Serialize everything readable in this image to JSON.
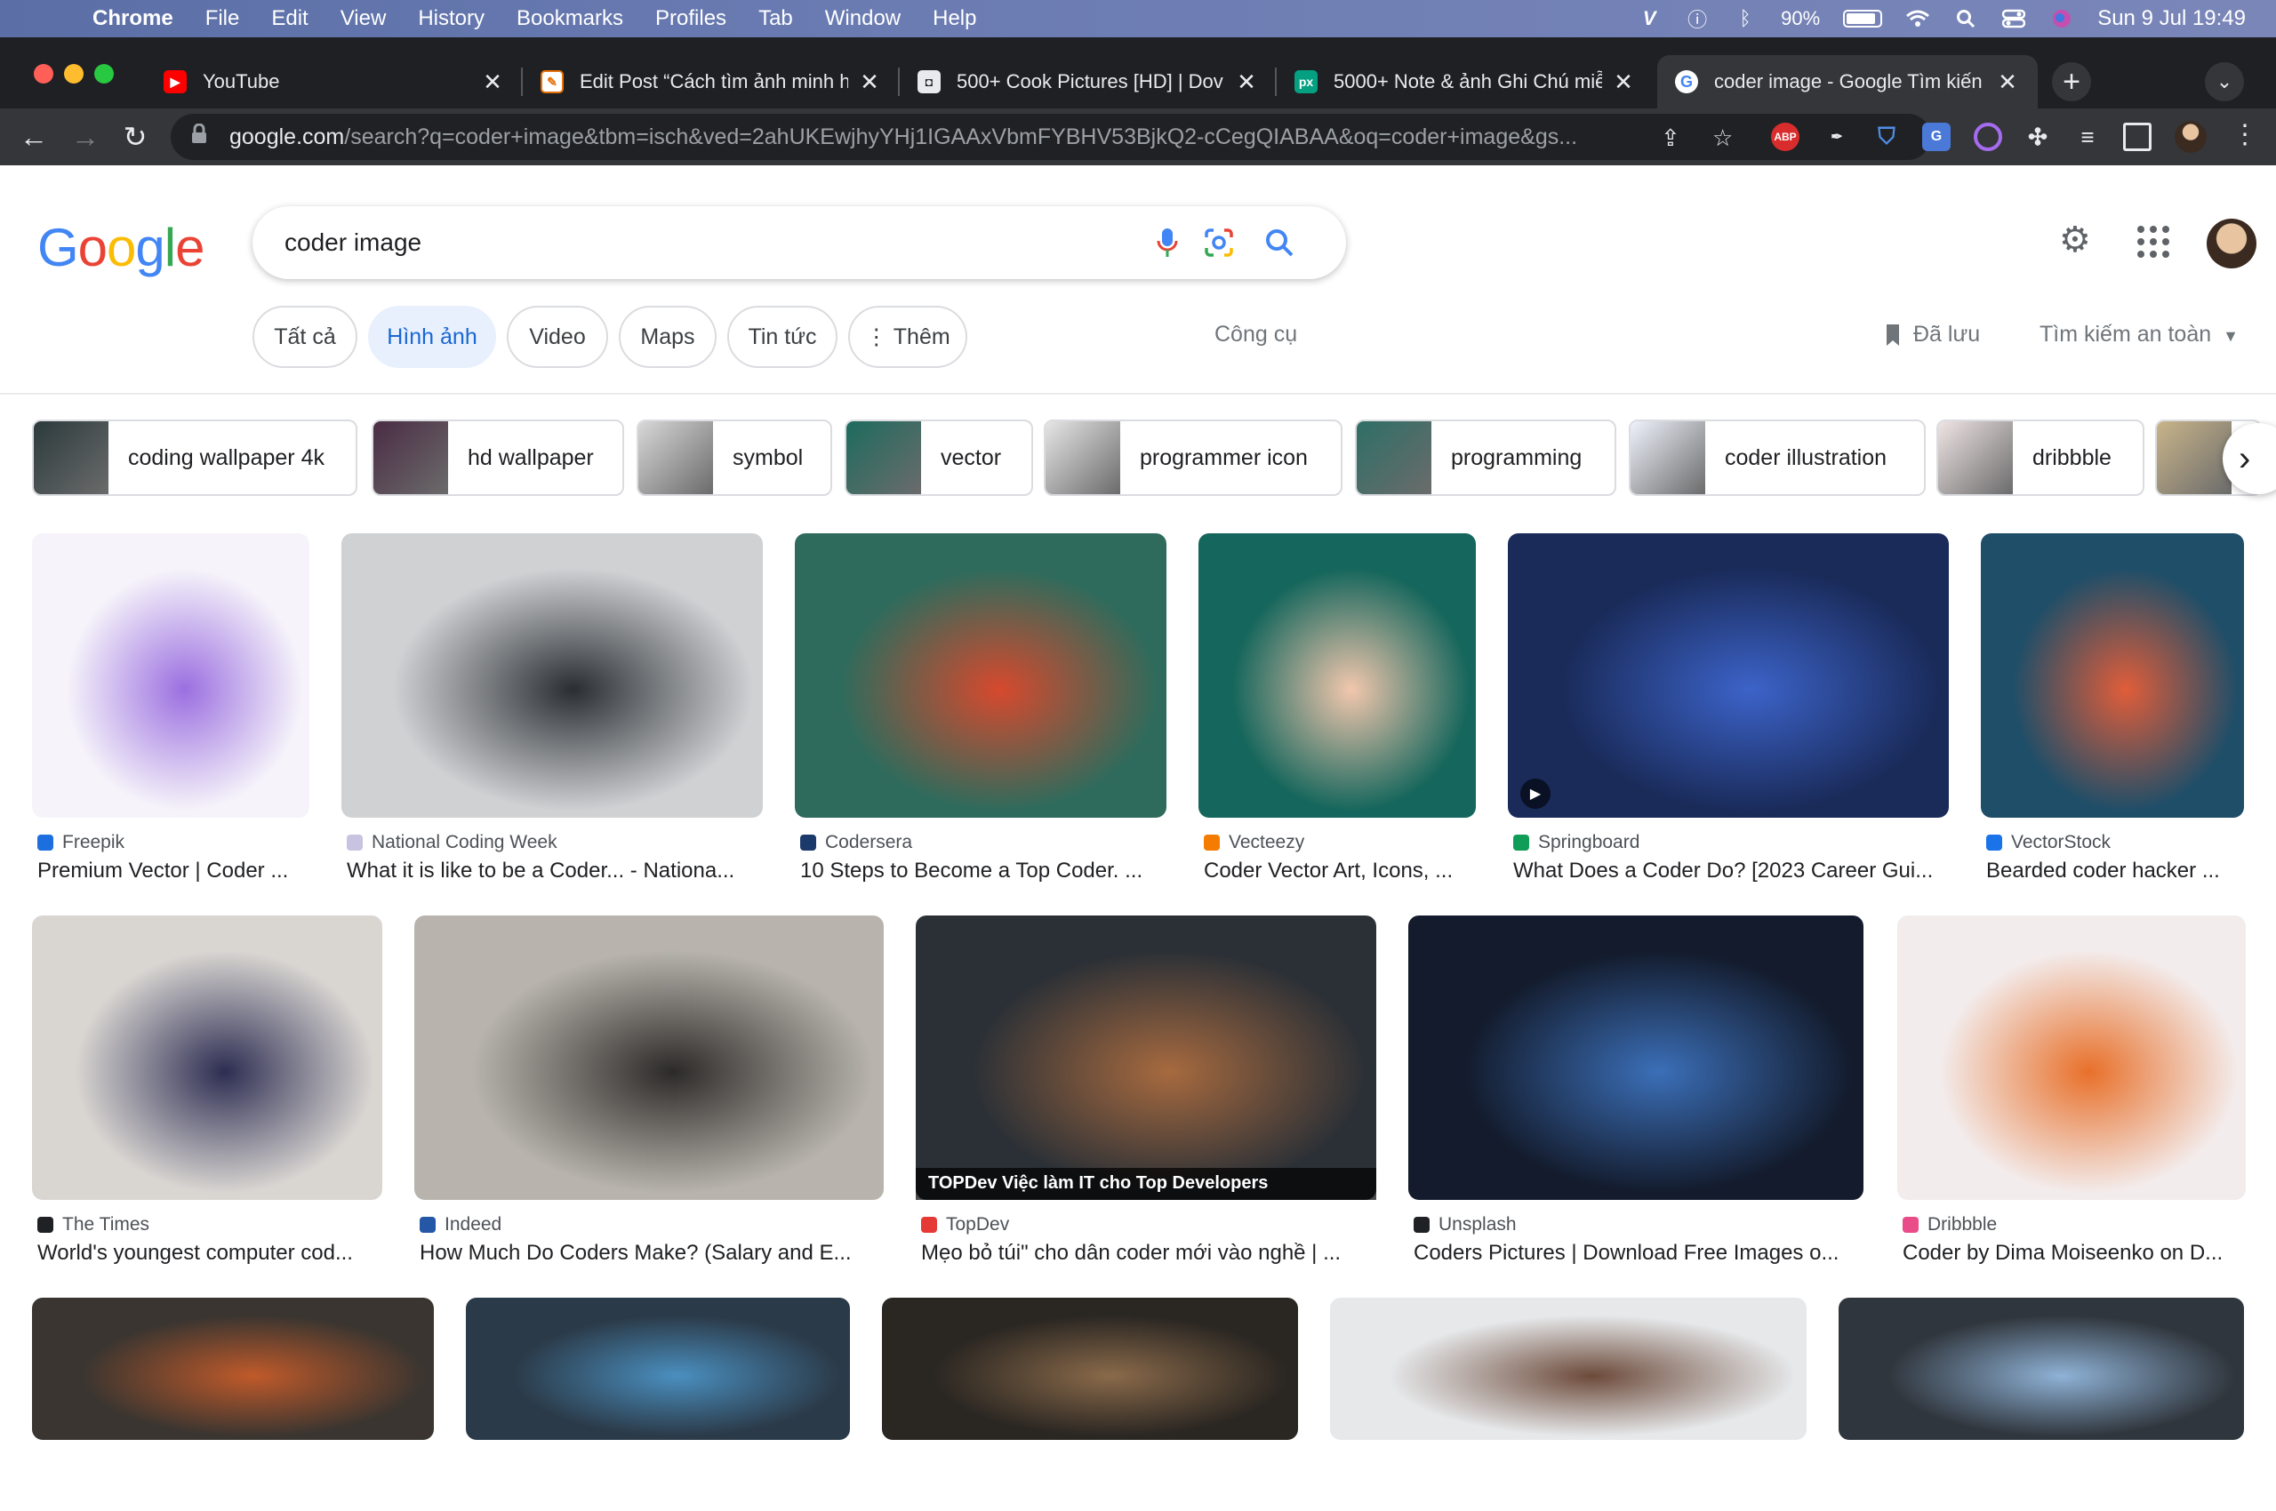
{
  "menubar": {
    "app": "Chrome",
    "items": [
      "File",
      "Edit",
      "View",
      "History",
      "Bookmarks",
      "Profiles",
      "Tab",
      "Window",
      "Help"
    ],
    "battery": "90%",
    "clock": "Sun 9 Jul  19:49"
  },
  "tabs": [
    {
      "title": "YouTube",
      "icon": "youtube-icon",
      "color": "#ff0000"
    },
    {
      "title": "Edit Post “Cách tìm ảnh minh h",
      "icon": "blog-icon",
      "color": "#e8710a"
    },
    {
      "title": "500+ Cook Pictures [HD] | Dov",
      "icon": "unsplash-icon",
      "color": "#202124"
    },
    {
      "title": "5000+ Note & ảnh Ghi Chú miễ",
      "icon": "pexels-icon",
      "color": "#05a081"
    },
    {
      "title": "coder image - Google Tìm kiến",
      "icon": "google-icon",
      "color": "#4285f4"
    }
  ],
  "url": {
    "domain": "google.com",
    "path": "/search?q=coder+image&tbm=isch&ved=2ahUKEwjhyYHj1IGAAxVbmFYBHV53BjkQ2-cCegQIABAA&oq=coder+image&gs..."
  },
  "extensions": [
    "abp-icon",
    "pen-icon",
    "shield-icon",
    "translate-icon",
    "ring-icon",
    "puzzle-icon",
    "playlist-icon",
    "sidepanel-icon"
  ],
  "extension_label_abp": "ABP",
  "search": {
    "query": "coder image"
  },
  "chips": [
    "Tất cả",
    "Hình ảnh",
    "Video",
    "Maps",
    "Tin tức",
    "⋮ Thêm"
  ],
  "tools_label": "Công cụ",
  "saved_label": "Đã lưu",
  "safe_label": "Tìm kiếm an toàn",
  "related": [
    {
      "label": "coding wallpaper 4k",
      "color": "#2b3a3c"
    },
    {
      "label": "hd wallpaper",
      "color": "#4a2c44"
    },
    {
      "label": "symbol",
      "color": "#d8d8d8"
    },
    {
      "label": "vector",
      "color": "#1d6b5e"
    },
    {
      "label": "programmer icon",
      "color": "#e6e6e6"
    },
    {
      "label": "programming",
      "color": "#2e6f66"
    },
    {
      "label": "coder illustration",
      "color": "#eef2fb"
    },
    {
      "label": "dribbble",
      "color": "#efe4e4"
    },
    {
      "label": "",
      "color": "#c9b48a"
    }
  ],
  "results": [
    {
      "source": "Freepik",
      "title": "Premium Vector | Coder ...",
      "fav": "#1d6fe0",
      "img": "#f6f4fa",
      "accent": "#9b6fe0"
    },
    {
      "source": "National Coding Week",
      "title": "What it is like to be a Coder... - Nationa...",
      "fav": "#c8c3e0",
      "img": "#cfd1d3",
      "accent": "#2a2e33"
    },
    {
      "source": "Codersera",
      "title": "10 Steps to Become a Top Coder. ...",
      "fav": "#1b3a6b",
      "img": "#2e6b5c",
      "accent": "#d6492d"
    },
    {
      "source": "Vecteezy",
      "title": "Coder Vector Art, Icons, ...",
      "fav": "#f57c00",
      "img": "#15665c",
      "accent": "#f2c7ad"
    },
    {
      "source": "Springboard",
      "title": "What Does a Coder Do? [2023 Career Gui...",
      "fav": "#0f9d58",
      "img": "#1a2b5a",
      "accent": "#3c63c9"
    },
    {
      "source": "VectorStock",
      "title": "Bearded coder hacker ...",
      "fav": "#1a73e8",
      "img": "#1f4e68",
      "accent": "#e05d3a"
    },
    {
      "source": "The Times",
      "title": "World's youngest computer cod...",
      "fav": "#202124",
      "img": "#d9d6d2",
      "accent": "#2d2d52"
    },
    {
      "source": "Indeed",
      "title": "How Much Do Coders Make? (Salary and E...",
      "fav": "#2557a7",
      "img": "#b8b4ad",
      "accent": "#2c2a28"
    },
    {
      "source": "TopDev",
      "title": "Mẹo bỏ túi\" cho dân coder mới vào nghề | ...",
      "fav": "#e53935",
      "img": "#2b3036",
      "accent": "#a76a3f"
    },
    {
      "source": "Unsplash",
      "title": "Coders Pictures | Download Free Images o...",
      "fav": "#202124",
      "img": "#131b2c",
      "accent": "#3b6fb8"
    },
    {
      "source": "Dribbble",
      "title": "Coder by Dima Moiseenko on D...",
      "fav": "#ea4c89",
      "img": "#f3ecec",
      "accent": "#e8702a"
    },
    {
      "source": "",
      "title": "",
      "fav": "#ffffff",
      "img": "#3a3530",
      "accent": "#c05a2a"
    },
    {
      "source": "",
      "title": "",
      "fav": "#ffffff",
      "img": "#2b3a48",
      "accent": "#4a8fbf"
    },
    {
      "source": "",
      "title": "",
      "fav": "#ffffff",
      "img": "#2a2622",
      "accent": "#8a6a4a"
    },
    {
      "source": "",
      "title": "",
      "fav": "#ffffff",
      "img": "#e6e8ea",
      "accent": "#6c4a3a"
    },
    {
      "source": "",
      "title": "",
      "fav": "#ffffff",
      "img": "#30363d",
      "accent": "#8fb2d6"
    }
  ],
  "topdev_banner": "TOPDev  Việc làm IT cho Top Developers"
}
